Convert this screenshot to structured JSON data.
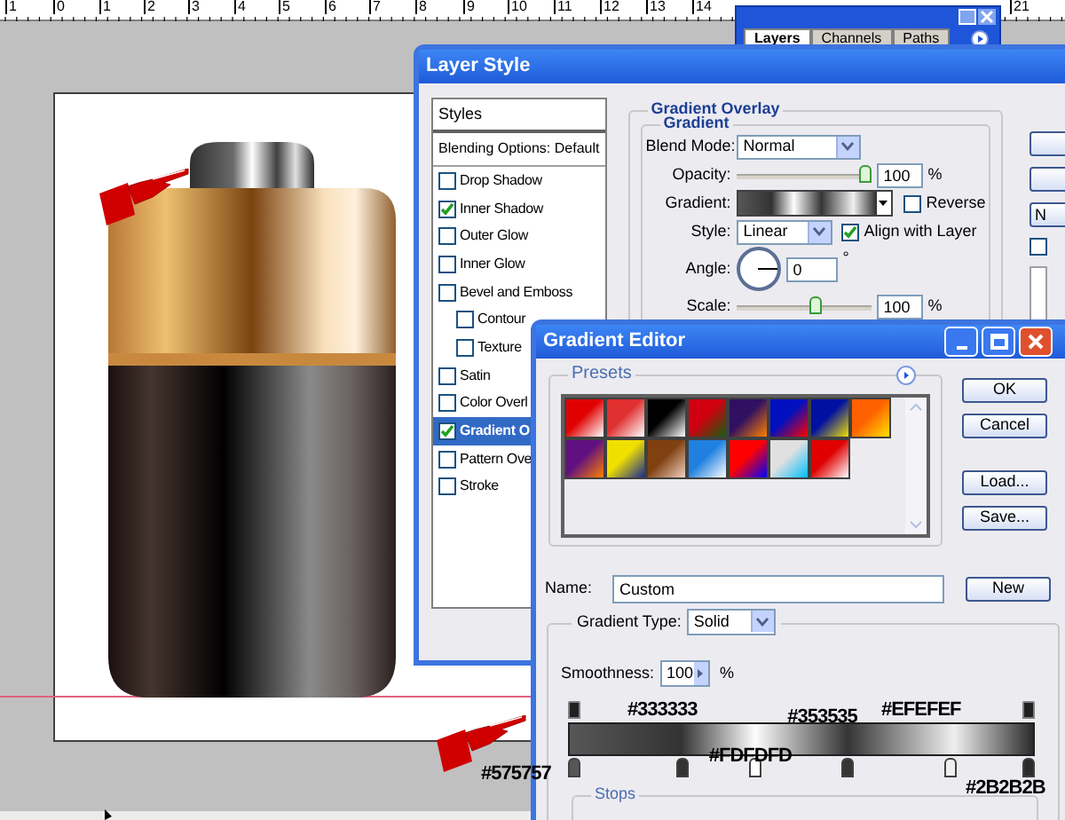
{
  "ruler": {
    "labels": [
      "1",
      "0",
      "1",
      "2",
      "3",
      "4",
      "5",
      "6",
      "7",
      "8",
      "9",
      "10",
      "11",
      "12",
      "13",
      "14",
      "21"
    ]
  },
  "layers_panel": {
    "tabs": [
      {
        "label": "Layers",
        "selected": true
      },
      {
        "label": "Channels",
        "selected": false
      },
      {
        "label": "Paths",
        "selected": false
      }
    ]
  },
  "layer_style": {
    "title": "Layer Style",
    "styles_header": "Styles",
    "blending_options": "Blending Options: Default",
    "styles": [
      {
        "label": "Drop Shadow",
        "kind": "top",
        "checked": false,
        "selected": false
      },
      {
        "label": "Inner Shadow",
        "kind": "top",
        "checked": true,
        "selected": false
      },
      {
        "label": "Outer Glow",
        "kind": "top",
        "checked": false,
        "selected": false
      },
      {
        "label": "Inner Glow",
        "kind": "top",
        "checked": false,
        "selected": false
      },
      {
        "label": "Bevel and Emboss",
        "kind": "top",
        "checked": false,
        "selected": false
      },
      {
        "label": "Contour",
        "kind": "sub",
        "checked": false,
        "selected": false
      },
      {
        "label": "Texture",
        "kind": "sub",
        "checked": false,
        "selected": false
      },
      {
        "label": "Satin",
        "kind": "top",
        "checked": false,
        "selected": false
      },
      {
        "label": "Color Overl",
        "kind": "top",
        "checked": false,
        "selected": false
      },
      {
        "label": "Gradient O",
        "kind": "top",
        "checked": true,
        "selected": true
      },
      {
        "label": "Pattern Ove",
        "kind": "top",
        "checked": false,
        "selected": false
      },
      {
        "label": "Stroke",
        "kind": "top",
        "checked": false,
        "selected": false
      }
    ],
    "gradient_overlay": {
      "group_title": "Gradient Overlay",
      "subgroup_title": "Gradient",
      "blend_mode_label": "Blend Mode:",
      "blend_mode": "Normal",
      "opacity": {
        "label": "Opacity:",
        "level": 1,
        "value": "100",
        "unit": "%"
      },
      "gradient_label": "Gradient:",
      "reverse": {
        "label": "Reverse",
        "checked": false
      },
      "style_label": "Style:",
      "style": "Linear",
      "align": {
        "label": "Align with Layer",
        "checked": true
      },
      "angle": {
        "label": "Angle:",
        "value": "0",
        "unit": "°"
      },
      "scale": {
        "label": "Scale:",
        "level": 0.6,
        "value": "100",
        "unit": "%"
      }
    },
    "side_button_label": "N",
    "preview_checked": false
  },
  "gradient_editor": {
    "title": "Gradient Editor",
    "presets_label": "Presets",
    "presets": [
      {
        "color": "#e00000"
      },
      {
        "color": "#e03030"
      },
      {
        "color": "#000000"
      },
      {
        "color": "#d00010"
      },
      {
        "color": "#301060"
      },
      {
        "color": "#0010c0"
      },
      {
        "color": "#0010a0"
      },
      {
        "color": "#ff6000"
      },
      {
        "color": "#601080"
      },
      {
        "color": "#f0e000"
      },
      {
        "color": "#804010"
      },
      {
        "color": "#2080e0"
      },
      {
        "color": "#ff0000"
      },
      {
        "color": "#e0e0e0"
      },
      {
        "color": "#e00000"
      }
    ],
    "buttons": [
      {
        "label": "OK"
      },
      {
        "label": "Cancel"
      },
      {
        "label": "Load..."
      },
      {
        "label": "Save..."
      }
    ],
    "name_label": "Name:",
    "name_value": "Custom",
    "new_button": "New",
    "gradient_type_label": "Gradient Type:",
    "gradient_type": "Solid",
    "smoothness_label": "Smoothness:",
    "smoothness": "100",
    "smoothness_unit": "%",
    "opacity_stops": [
      {
        "level": 0
      },
      {
        "level": 1
      }
    ],
    "color_stops": [
      {
        "level": 0,
        "color": "#575757",
        "label": "#575757"
      },
      {
        "level": 0.24,
        "color": "#333333",
        "label": "#333333"
      },
      {
        "level": 0.4,
        "color": "#fdfdfd",
        "label": "#FDFDFD"
      },
      {
        "level": 0.6,
        "color": "#353535",
        "label": "#353535"
      },
      {
        "level": 0.83,
        "color": "#efefef",
        "label": "#EFEFEF"
      },
      {
        "level": 1,
        "color": "#2b2b2b",
        "label": "#2B2B2B"
      }
    ],
    "stops_label": "Stops"
  }
}
